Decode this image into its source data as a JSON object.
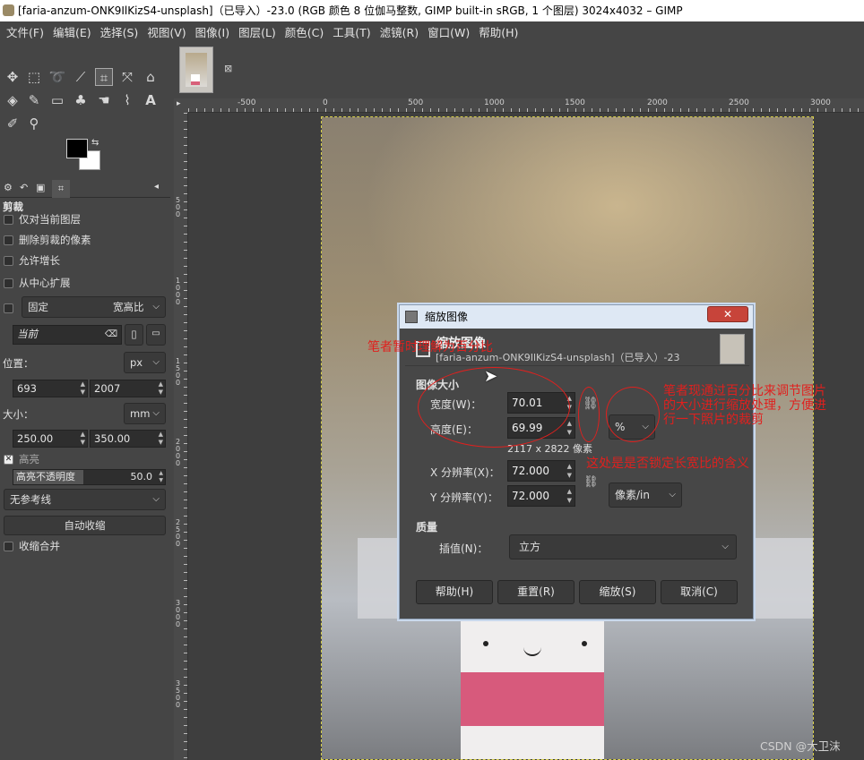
{
  "window": {
    "title": "[faria-anzum-ONK9IlKizS4-unsplash]（已导入）-23.0 (RGB 颜色 8 位伽马整数, GIMP built-in sRGB, 1 个图层) 3024x4032 – GIMP"
  },
  "menu": [
    "文件(F)",
    "编辑(E)",
    "选择(S)",
    "视图(V)",
    "图像(I)",
    "图层(L)",
    "颜色(C)",
    "工具(T)",
    "滤镜(R)",
    "窗口(W)",
    "帮助(H)"
  ],
  "tool_options": {
    "title": "剪裁",
    "current_layer_only": "仅对当前图层",
    "delete_cropped": "删除剪裁的像素",
    "allow_growing": "允许增长",
    "expand_from_center": "从中心扩展",
    "fixed_label": "固定",
    "fixed_value": "宽高比",
    "current_placeholder": "当前",
    "position_label": "位置：",
    "position_unit": "px",
    "pos_x": "693",
    "pos_y": "2007",
    "size_label": "大小：",
    "size_unit": "mm",
    "size_w": "250.00",
    "size_h": "350.00",
    "highlight": "高亮",
    "highlight_opacity_label": "高亮不透明度",
    "highlight_opacity_value": "50.0",
    "guides": "无参考线",
    "auto_shrink": "自动收缩",
    "shrink_merged": "收缩合并"
  },
  "rulers": {
    "h_ticks": [
      "-500",
      "0",
      "500",
      "1000",
      "1500",
      "2000",
      "2500",
      "3000"
    ],
    "v_ticks": [
      "500",
      "1000",
      "1500",
      "2000",
      "2500",
      "3000",
      "3500"
    ]
  },
  "dialog": {
    "window_title": "缩放图像",
    "header_title": "缩放图像",
    "header_subtitle": "[faria-anzum-ONK9IlKizS4-unsplash]（已导入）-23",
    "image_size_label": "图像大小",
    "width_label": "宽度(W)：",
    "width_value": "70.01",
    "height_label": "高度(E)：",
    "height_value": "69.99",
    "unit": "%",
    "pixel_size": "2117 x 2822 像素",
    "xres_label": "X 分辨率(X)：",
    "xres_value": "72.000",
    "yres_label": "Y 分辨率(Y)：",
    "yres_value": "72.000",
    "res_unit": "像素/in",
    "quality_label": "质量",
    "interp_label": "插值(N)：",
    "interp_value": "立方",
    "buttons": {
      "help": "帮助(H)",
      "reset": "重置(R)",
      "scale": "缩放(S)",
      "cancel": "取消(C)"
    }
  },
  "annotations": {
    "a1": "笔者暂时理解为百分比",
    "a2_line1": "笔者现通过百分比来调节图片",
    "a2_line2": "的大小进行缩放处理，方便进",
    "a2_line3": "行一下照片的裁剪",
    "a3": "这处是是否锁定长宽比的含义"
  },
  "watermark": "CSDN @大卫沫"
}
